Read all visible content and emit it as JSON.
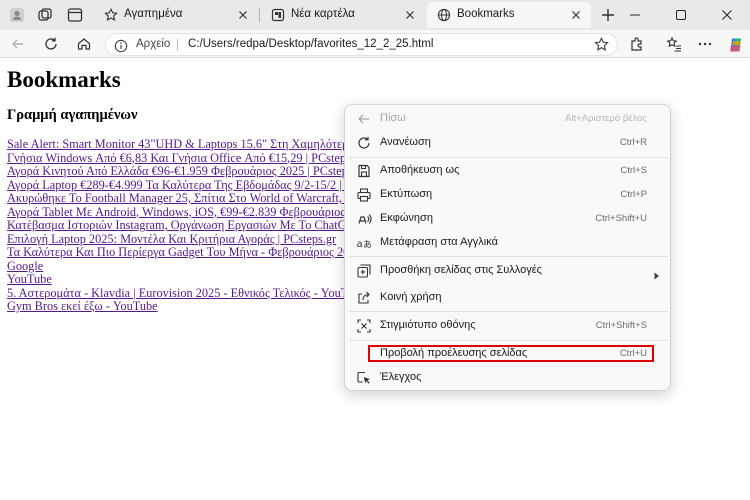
{
  "tabs": [
    {
      "title": "Αγαπημένα",
      "icon": "star-favorites-icon"
    },
    {
      "title": "Νέα καρτέλα",
      "icon": "new-tab-page-icon"
    },
    {
      "title": "Bookmarks",
      "icon": "globe-icon"
    }
  ],
  "address": {
    "scheme_label": "Αρχείο",
    "url": "C:/Users/redpa/Desktop/favorites_12_2_25.html"
  },
  "page": {
    "heading": "Bookmarks",
    "subheading": "Γραμμή αγαπημένων",
    "links": [
      "Sale Alert: Smart Monitor 43\"UHD & Laptops 15.6\" Στη Χαμηλότερη",
      "Γνήσια Windows Από €6,83 Και Γνήσια Office Από €15,29 | PCsteps.",
      "Αγορά Κινητού Από Ελλάδα €96-€1.959 Φεβρουάριος 2025 | PCsteps.",
      "Αγορά Laptop €289-€4.999 Τα Καλύτερα Της Εβδομάδας 9/2-15/2 | P",
      "Ακυρώθηκε Το Football Manager 25, Σπίτια Στο World of Warcraft, E",
      "Αγορά Tablet Με Android, Windows, iOS, €99-€2.839 Φεβρουάριος 2",
      "Κατέβασμα Ιστοριών Instagram, Οργάνωση Εργασιών Με Το ChatGP",
      "Επιλογή Laptop 2025: Μοντέλα Και Κριτήρια Αγοράς | PCsteps.gr",
      "Τα Καλύτερα Και Πιο Περίεργα Gadget Του Μήνα - Φεβρουάριος 202",
      "Google",
      "YouTube",
      "5. Αστερομάτα - Klavdia | Eurovision 2025 - Εθνικός Τελικός - YouTu",
      "Gym Bros εκεί έξω - YouTube"
    ]
  },
  "context_menu": {
    "items": [
      {
        "label": "Πίσω",
        "shortcut": "Alt+Αριστερό βέλος",
        "icon": "back-arrow-icon",
        "disabled": true
      },
      {
        "label": "Ανανέωση",
        "shortcut": "Ctrl+R",
        "icon": "refresh-icon"
      },
      {
        "label": "Αποθήκευση ως",
        "shortcut": "Ctrl+S",
        "icon": "save-icon"
      },
      {
        "label": "Εκτύπωση",
        "shortcut": "Ctrl+P",
        "icon": "print-icon"
      },
      {
        "label": "Εκφώνηση",
        "shortcut": "Ctrl+Shift+U",
        "icon": "read-aloud-icon"
      },
      {
        "label": "Μετάφραση στα Αγγλικά",
        "shortcut": "",
        "icon": "translate-icon"
      },
      {
        "label": "Προσθήκη σελίδας στις Συλλογές",
        "shortcut": "",
        "icon": "collections-icon",
        "submenu": true
      },
      {
        "label": "Κοινή χρήση",
        "shortcut": "",
        "icon": "share-icon"
      },
      {
        "label": "Στιγμιότυπο οθόνης",
        "shortcut": "Ctrl+Shift+S",
        "icon": "screenshot-icon"
      },
      {
        "label": "Προβολή προέλευσης σελίδας",
        "shortcut": "Ctrl+U",
        "icon": "",
        "highlighted": true
      },
      {
        "label": "Έλεγχος",
        "shortcut": "",
        "icon": "inspect-icon"
      }
    ]
  },
  "colors": {
    "link_visited": "#551a8b",
    "highlight_border": "#e00000",
    "tabstrip_bg": "#e9e9e9"
  }
}
